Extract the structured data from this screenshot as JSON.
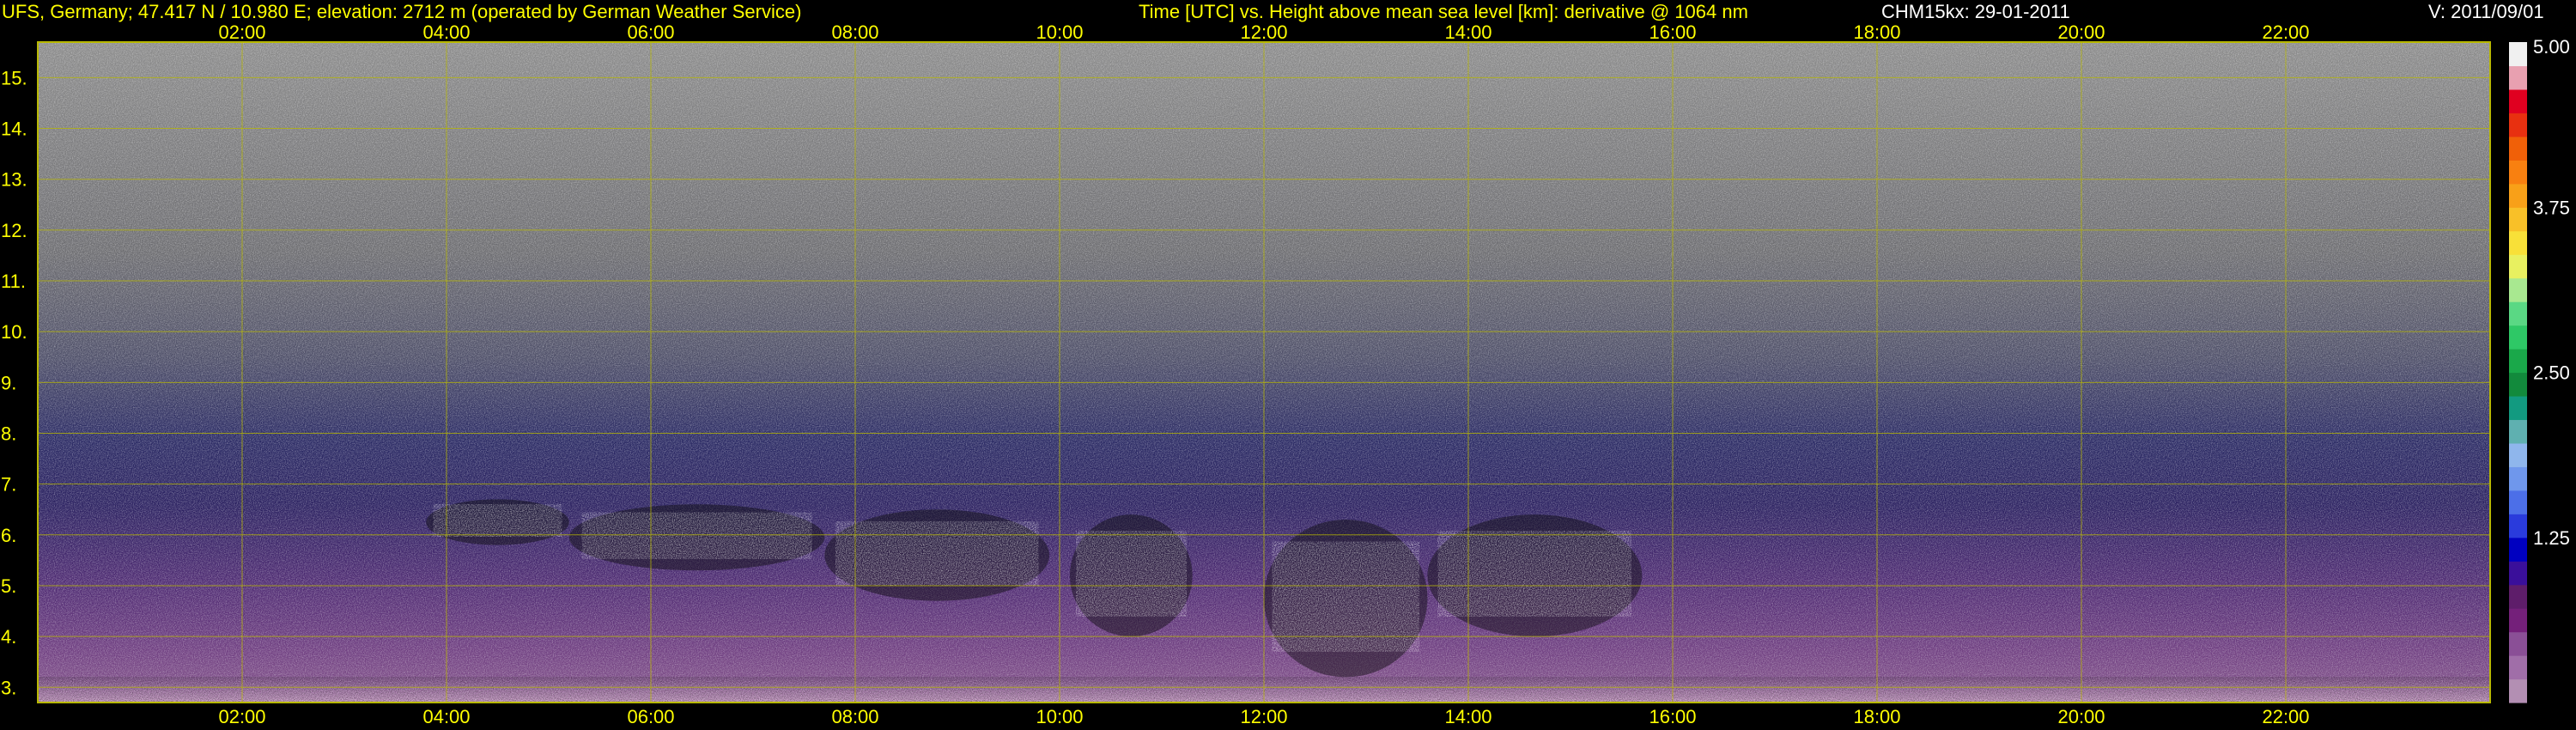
{
  "header": {
    "station": "UFS, Germany; 47.417 N / 10.980 E; elevation: 2712 m  (operated by German Weather Service)",
    "plot_description": "Time [UTC] vs. Height above mean sea level [km]: derivative @ 1064 nm",
    "instrument_date": "CHM15kx: 29-01-2011",
    "version": "V: 2011/09/01",
    "text_color": "#ffff00",
    "version_color": "#ffffff"
  },
  "chart_data": {
    "type": "heatmap",
    "title": "Time [UTC] vs. Height above mean sea level [km]: derivative @ 1064 nm",
    "x": {
      "label": "Time [UTC]",
      "unit": "h",
      "range": [
        0,
        24
      ],
      "tick_values": [
        2,
        4,
        6,
        8,
        10,
        12,
        14,
        16,
        18,
        20,
        22
      ],
      "tick_labels": [
        "02:00",
        "04:00",
        "06:00",
        "08:00",
        "10:00",
        "12:00",
        "14:00",
        "16:00",
        "18:00",
        "20:00",
        "22:00"
      ]
    },
    "y": {
      "label": "Height above mean sea level [km]",
      "unit": "km",
      "range": [
        2.7,
        15.7
      ],
      "tick_values": [
        3,
        4,
        5,
        6,
        7,
        8,
        9,
        10,
        11,
        12,
        13,
        14,
        15
      ],
      "tick_labels": [
        "3.",
        "4.",
        "5.",
        "6.",
        "7.",
        "8.",
        "9.",
        "10.",
        "11.",
        "12.",
        "13.",
        "14.",
        "15."
      ]
    },
    "colorbar": {
      "range": [
        0,
        5
      ],
      "tick_values": [
        1.25,
        2.5,
        3.75,
        5.0
      ],
      "tick_labels": [
        "1.25",
        "2.50",
        "3.75",
        "5.00"
      ],
      "colors": [
        "#b38fb3",
        "#a06ea8",
        "#8a4f96",
        "#74207a",
        "#5e1d6a",
        "#3a0f9a",
        "#0000c0",
        "#2a3bdc",
        "#4c6fe8",
        "#6f97ec",
        "#8fb6ec",
        "#5fb0b0",
        "#129a80",
        "#128a3c",
        "#1aa84a",
        "#2ec866",
        "#5ad884",
        "#a8e890",
        "#e8f060",
        "#f8e038",
        "#f8c028",
        "#f8a018",
        "#f88010",
        "#f06008",
        "#e83010",
        "#e00020",
        "#e8a0b0",
        "#f0f0f0"
      ]
    },
    "grid": true,
    "grid_color": "#b8b800",
    "axis_text_color": "#ffff00",
    "features": [
      {
        "name": "cloud",
        "time_range": [
          3.8,
          5.2
        ],
        "height_range": [
          5.8,
          6.7
        ]
      },
      {
        "name": "cloud",
        "time_range": [
          5.2,
          7.7
        ],
        "height_range": [
          5.3,
          6.6
        ]
      },
      {
        "name": "cloud",
        "time_range": [
          7.7,
          9.9
        ],
        "height_range": [
          4.7,
          6.5
        ]
      },
      {
        "name": "cloud",
        "time_range": [
          10.1,
          11.3
        ],
        "height_range": [
          4.0,
          6.4
        ]
      },
      {
        "name": "cloud",
        "time_range": [
          12.0,
          13.6
        ],
        "height_range": [
          3.2,
          6.3
        ]
      },
      {
        "name": "cloud",
        "time_range": [
          13.6,
          15.7
        ],
        "height_range": [
          4.0,
          6.4
        ]
      }
    ]
  }
}
